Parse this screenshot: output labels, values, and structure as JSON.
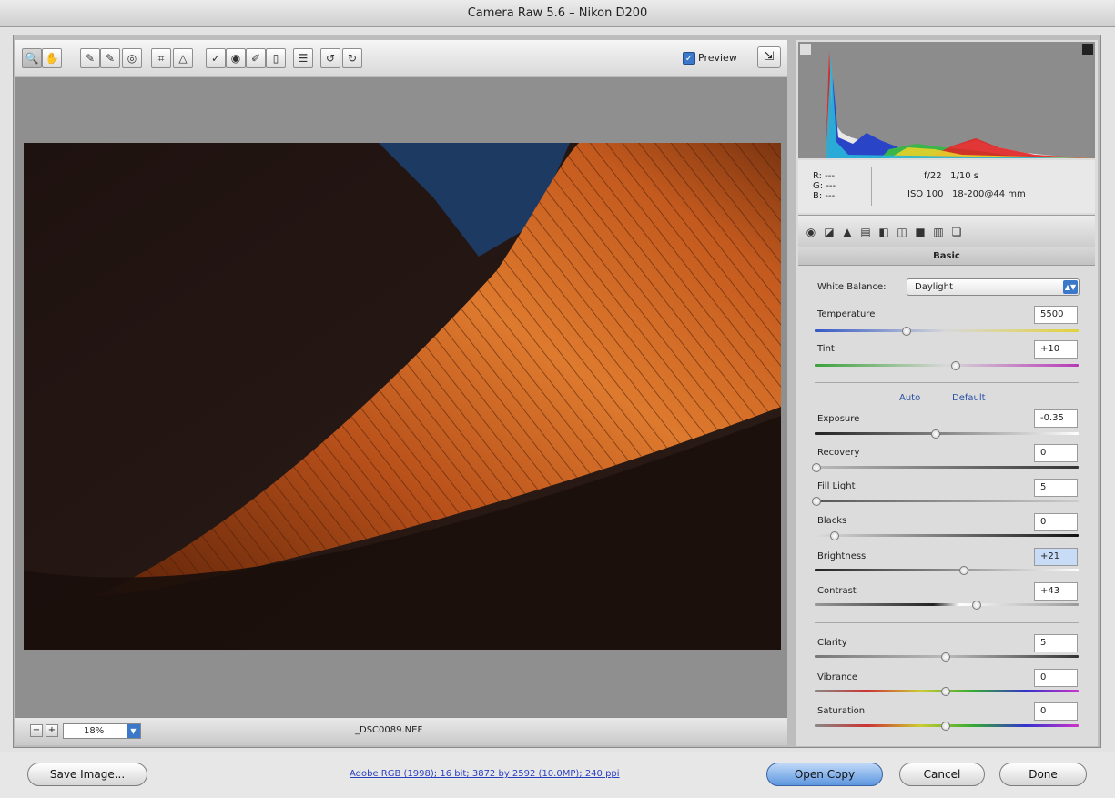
{
  "window": {
    "title": "Camera Raw 5.6  –  Nikon D200"
  },
  "toolbar": {
    "tools": [
      {
        "name": "zoom-tool",
        "glyph": "🔍"
      },
      {
        "name": "hand-tool",
        "glyph": "✋"
      },
      {
        "name": "white-balance-tool",
        "glyph": "✎"
      },
      {
        "name": "color-sampler-tool",
        "glyph": "✎"
      },
      {
        "name": "targeted-adjustment-tool",
        "glyph": "◎"
      },
      {
        "name": "crop-tool",
        "glyph": "⌗"
      },
      {
        "name": "straighten-tool",
        "glyph": "△"
      },
      {
        "name": "spot-removal-tool",
        "glyph": "✓"
      },
      {
        "name": "red-eye-tool",
        "glyph": "◉"
      },
      {
        "name": "adjustment-brush-tool",
        "glyph": "✐"
      },
      {
        "name": "graduated-filter-tool",
        "glyph": "▯"
      },
      {
        "name": "preferences-tool",
        "glyph": "☰"
      },
      {
        "name": "rotate-ccw-tool",
        "glyph": "↺"
      },
      {
        "name": "rotate-cw-tool",
        "glyph": "↻"
      }
    ],
    "preview_label": "Preview",
    "preview_checked": true
  },
  "bottombar": {
    "zoom_value": "18%",
    "filename": "_DSC0089.NEF"
  },
  "info": {
    "r_label": "R:",
    "r_value": "---",
    "g_label": "G:",
    "g_value": "---",
    "b_label": "B:",
    "b_value": "---",
    "aperture": "f/22",
    "shutter": "1/10 s",
    "iso": "ISO 100",
    "lens": "18-200@44 mm"
  },
  "panel": {
    "section_title": "Basic",
    "white_balance_label": "White Balance:",
    "white_balance_value": "Daylight",
    "auto_label": "Auto",
    "default_label": "Default"
  },
  "sliders": {
    "temperature": {
      "label": "Temperature",
      "value": "5500",
      "position": 0.35
    },
    "tint": {
      "label": "Tint",
      "value": "+10",
      "position": 0.54
    },
    "exposure": {
      "label": "Exposure",
      "value": "-0.35",
      "position": 0.46
    },
    "recovery": {
      "label": "Recovery",
      "value": "0",
      "position": 0.0
    },
    "fill_light": {
      "label": "Fill Light",
      "value": "5",
      "position": 0.0
    },
    "blacks": {
      "label": "Blacks",
      "value": "0",
      "position": 0.07
    },
    "brightness": {
      "label": "Brightness",
      "value": "+21",
      "position": 0.57
    },
    "contrast": {
      "label": "Contrast",
      "value": "+43",
      "position": 0.62
    },
    "clarity": {
      "label": "Clarity",
      "value": "5",
      "position": 0.5
    },
    "vibrance": {
      "label": "Vibrance",
      "value": "0",
      "position": 0.5
    },
    "saturation": {
      "label": "Saturation",
      "value": "0",
      "position": 0.5
    }
  },
  "footer": {
    "save_label": "Save Image...",
    "workflow_link": "Adobe RGB (1998); 16 bit; 3872 by 2592 (10.0MP); 240 ppi",
    "open_label": "Open Copy",
    "cancel_label": "Cancel",
    "done_label": "Done"
  },
  "colors": {
    "accent": "#3b78c9"
  }
}
